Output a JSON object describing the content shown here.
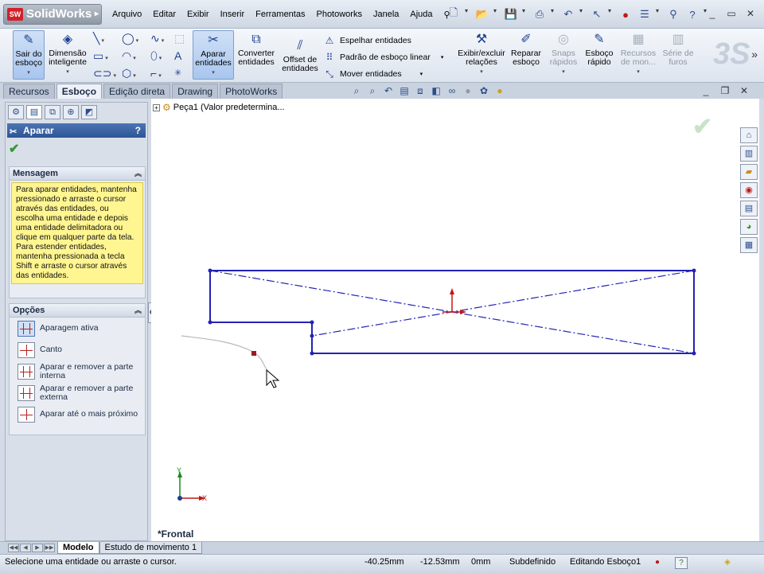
{
  "app": {
    "name": "SolidWorks",
    "badge": "SW"
  },
  "menu": [
    "Arquivo",
    "Editar",
    "Exibir",
    "Inserir",
    "Ferramentas",
    "Photoworks",
    "Janela",
    "Ajuda"
  ],
  "ribbon": {
    "exit_sketch": "Sair do esboço",
    "smart_dimension": "Dimensão inteligente",
    "trim_entities": "Aparar entidades",
    "convert_entities": "Converter entidades",
    "offset_entities": "Offset de entidades",
    "mirror_entities": "Espelhar entidades",
    "linear_pattern": "Padrão de esboço linear",
    "move_entities": "Mover entidades",
    "display_relations": "Exibir/excluir relações",
    "repair_sketch": "Reparar esboço",
    "quick_snaps": "Snaps rápidos",
    "rapid_sketch": "Esboço rápido",
    "mold_tools": "Recursos de mon...",
    "hole_series": "Série de furos"
  },
  "command_tabs": [
    {
      "label": "Recursos",
      "active": false
    },
    {
      "label": "Esboço",
      "active": true
    },
    {
      "label": "Edição direta",
      "active": false
    },
    {
      "label": "Drawing",
      "active": false
    },
    {
      "label": "PhotoWorks",
      "active": false
    }
  ],
  "tree": {
    "part": "Peça1  (Valor predetermina..."
  },
  "property_manager": {
    "title": "Aparar",
    "message_title": "Mensagem",
    "message": "Para aparar entidades, mantenha pressionado e arraste o cursor através das entidades, ou escolha uma entidade e depois uma entidade delimitadora ou clique em qualquer parte da tela. Para estender entidades, mantenha pressionada a tecla Shift e arraste o cursor através das entidades.",
    "options_title": "Opções",
    "options": [
      {
        "label": "Aparagem ativa",
        "selected": true
      },
      {
        "label": "Canto",
        "selected": false
      },
      {
        "label": "Aparar e remover a parte interna",
        "selected": false
      },
      {
        "label": "Aparar e remover a parte externa",
        "selected": false
      },
      {
        "label": "Aparar até o mais próximo",
        "selected": false
      }
    ]
  },
  "graphics": {
    "view_name": "*Frontal",
    "triad": {
      "x": "X",
      "y": "Y"
    },
    "sketch_color": "#2323b5",
    "origin_color": "#c01818"
  },
  "bottom_tabs": [
    {
      "label": "Modelo",
      "active": true
    },
    {
      "label": "Estudo de movimento 1",
      "active": false
    }
  ],
  "status": {
    "message": "Selecione uma entidade ou arraste o cursor.",
    "x": "-40.25mm",
    "y": "-12.53mm",
    "z": "0mm",
    "definition": "Subdefinido",
    "editing": "Editando Esboço1"
  }
}
